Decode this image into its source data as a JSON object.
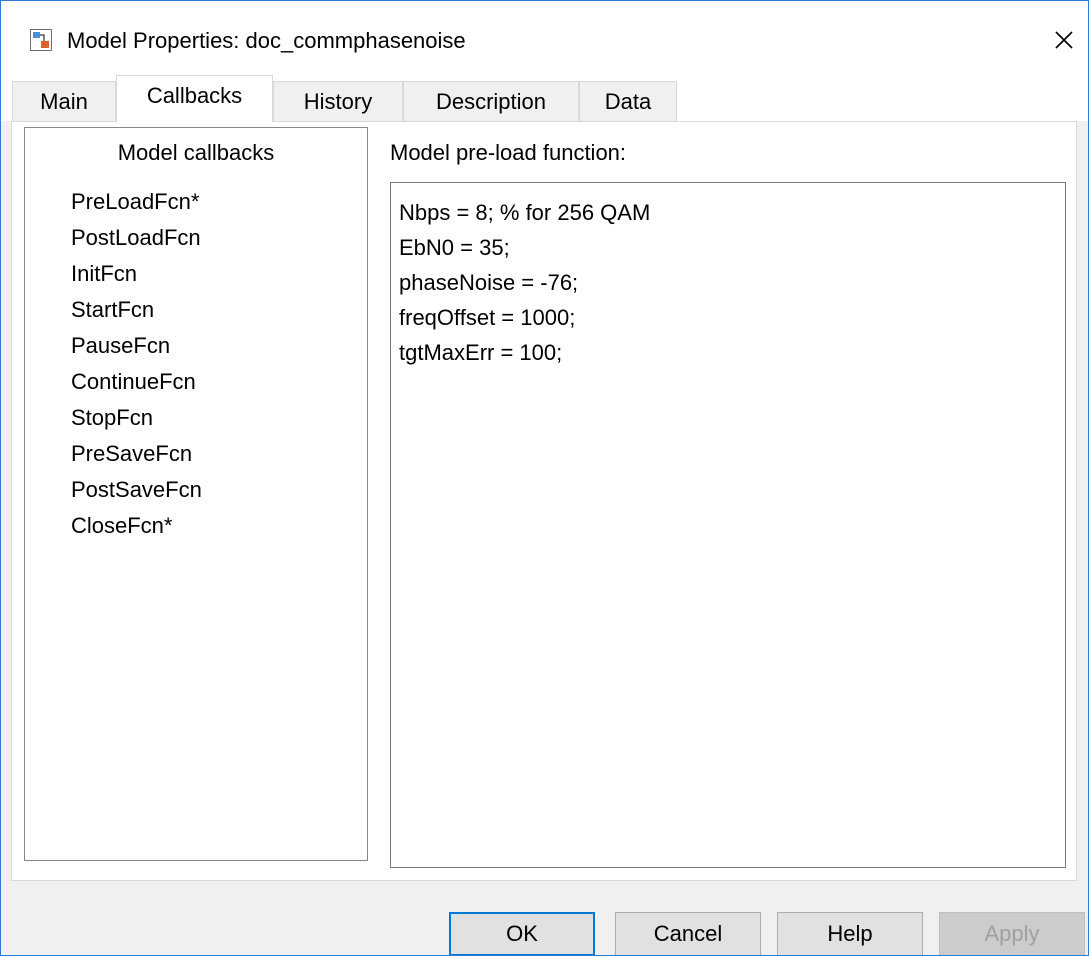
{
  "window": {
    "title": "Model Properties: doc_commphasenoise",
    "icon": "simulink-model-icon",
    "close_icon": "close-icon"
  },
  "tabs": [
    {
      "label": "Main",
      "active": false
    },
    {
      "label": "Callbacks",
      "active": true
    },
    {
      "label": "History",
      "active": false
    },
    {
      "label": "Description",
      "active": false
    },
    {
      "label": "Data",
      "active": false
    }
  ],
  "callbacks": {
    "header": "Model callbacks",
    "items": [
      "PreLoadFcn*",
      "PostLoadFcn",
      "InitFcn",
      "StartFcn",
      "PauseFcn",
      "ContinueFcn",
      "StopFcn",
      "PreSaveFcn",
      "PostSaveFcn",
      "CloseFcn*"
    ]
  },
  "editor": {
    "label": "Model pre-load function:",
    "lines": [
      "Nbps = 8; % for 256 QAM",
      "EbN0 = 35;",
      "phaseNoise = -76;",
      "freqOffset = 1000;",
      "tgtMaxErr = 100;"
    ]
  },
  "buttons": {
    "ok": "OK",
    "cancel": "Cancel",
    "help": "Help",
    "apply": "Apply"
  },
  "colors": {
    "window_border": "#2b7bd4",
    "default_button_border": "#0078d7",
    "disabled_text": "#a0a0a0"
  }
}
